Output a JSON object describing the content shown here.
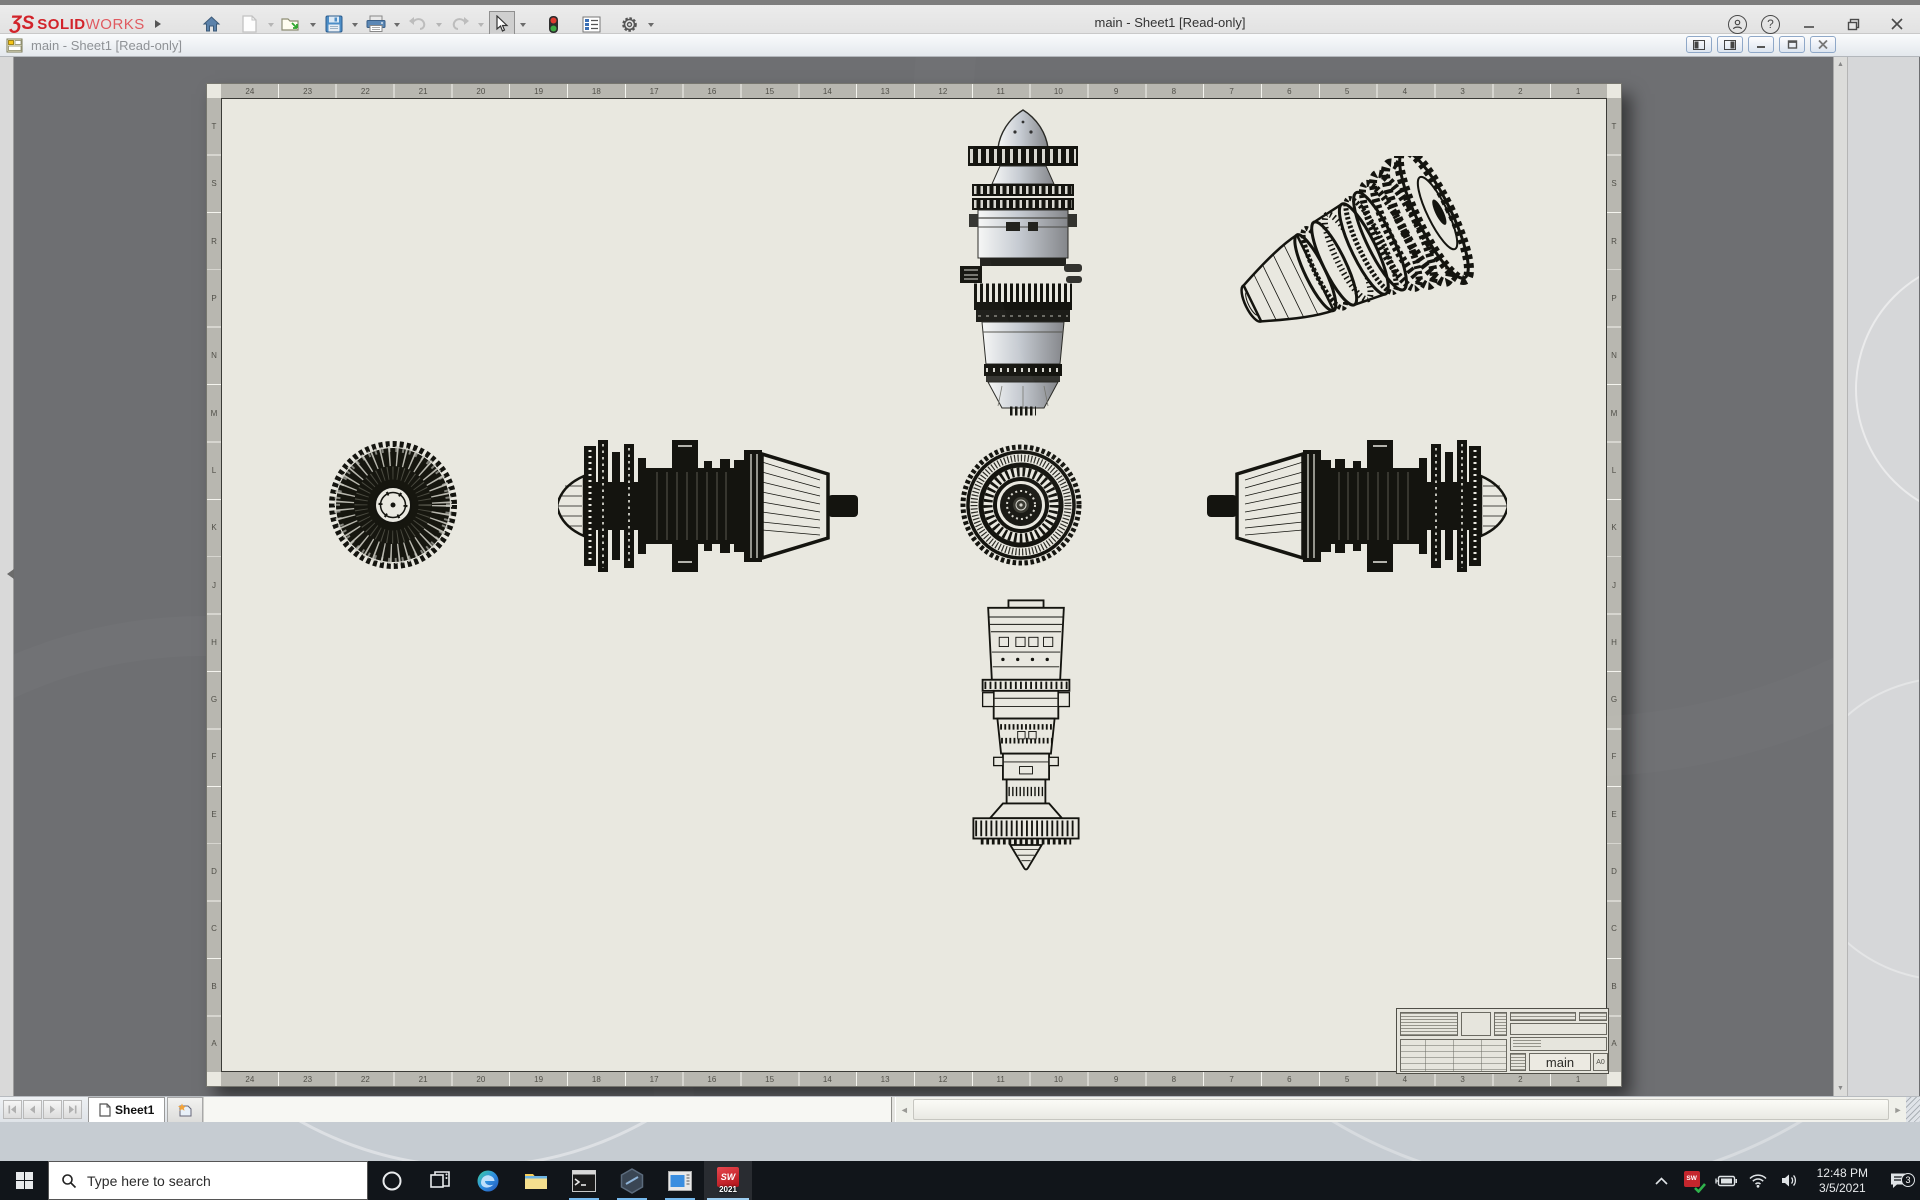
{
  "app": {
    "brand": {
      "mark": "ƷS",
      "bold": "SOLID",
      "light": "WORKS"
    },
    "title": "main - Sheet1 [Read-only]",
    "help_glyph": "?"
  },
  "document_window": {
    "title": "main - Sheet1 [Read-only]"
  },
  "sheet": {
    "zone_numbers": [
      "24",
      "23",
      "22",
      "21",
      "20",
      "19",
      "18",
      "17",
      "16",
      "15",
      "14",
      "13",
      "12",
      "11",
      "10",
      "9",
      "8",
      "7",
      "6",
      "5",
      "4",
      "3",
      "2",
      "1"
    ],
    "zone_letters": [
      "T",
      "S",
      "R",
      "P",
      "N",
      "M",
      "L",
      "K",
      "J",
      "H",
      "G",
      "F",
      "E",
      "D",
      "C",
      "B",
      "A"
    ],
    "title_block": {
      "drawing_number": "main",
      "size": "A0"
    }
  },
  "bottom_bar": {
    "sheet_tab": "Sheet1"
  },
  "taskbar": {
    "search_placeholder": "Type here to search",
    "time": "12:48 PM",
    "date": "3/5/2021",
    "notification_count": "3",
    "solidworks_icon": {
      "line1": "SW",
      "line2": "2021"
    },
    "tray_shield": "SW"
  },
  "colors": {
    "accent": "#76b9ed",
    "brand_red": "#d2232a",
    "taskbar_bg": "#11151a",
    "sheet_bg": "#e9e8e0",
    "viewport_bg": "#6e6f72",
    "engine_ink": "#14140f"
  }
}
